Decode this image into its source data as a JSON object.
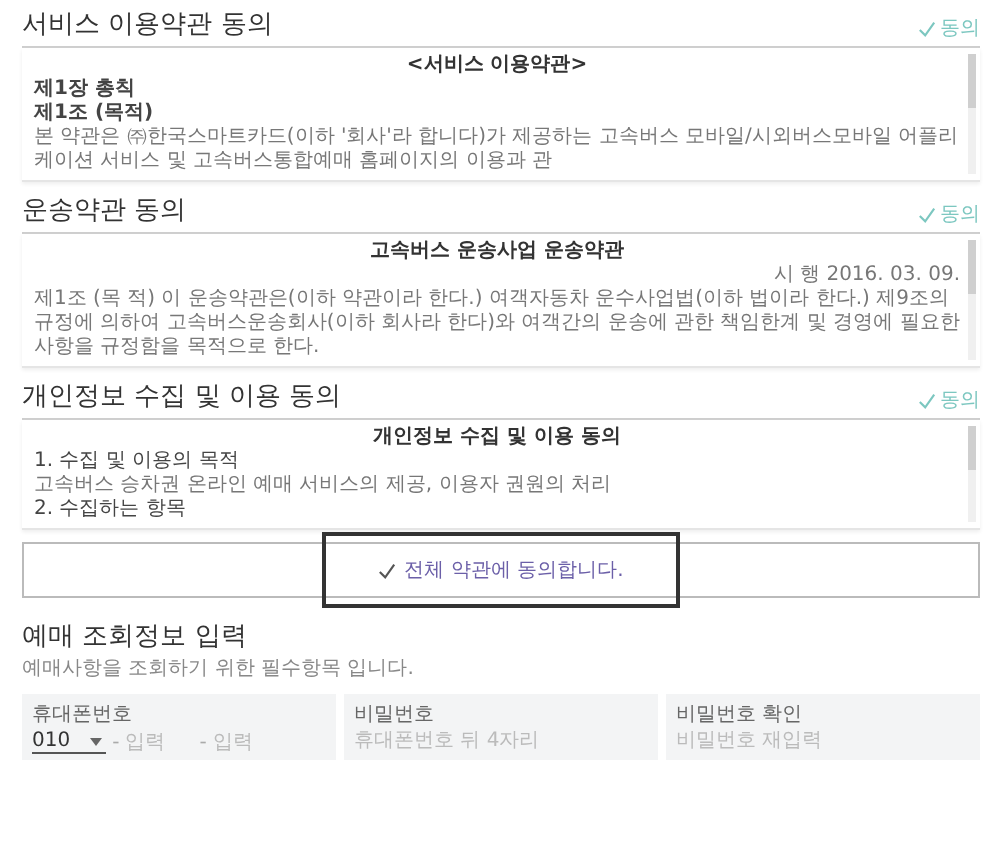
{
  "sections": [
    {
      "title": "서비스 이용약관 동의",
      "agree_label": "동의",
      "content": [
        {
          "kind": "heading",
          "text": "<서비스 이용약관>"
        },
        {
          "kind": "bold",
          "text": "제1장 총칙"
        },
        {
          "kind": "bold",
          "text": "제1조 (목적)"
        },
        {
          "kind": "text",
          "text": "본 약관은 ㈜한국스마트카드(이하 '회사'라 합니다)가 제공하는 고속버스 모바일/시외버스모바일 어플리케이션 서비스 및 고속버스통합예매 홈페이지의 이용과 관"
        }
      ]
    },
    {
      "title": "운송약관 동의",
      "agree_label": "동의",
      "content": [
        {
          "kind": "heading",
          "text": "고속버스 운송사업 운송약관"
        },
        {
          "kind": "date",
          "text": "시 행 2016. 03. 09."
        },
        {
          "kind": "text",
          "text": "제1조 (목 적) 이 운송약관은(이하 약관이라 한다.) 여객자동차 운수사업법(이하 법이라 한다.) 제9조의 규정에 의하여 고속버스운송회사(이하 회사라 한다)와 여객간의 운송에 관한 책임한계 및 경영에 필요한 사항을 규정함을 목적으로 한다."
        }
      ]
    },
    {
      "title": "개인정보 수집 및 이용 동의",
      "agree_label": "동의",
      "content": [
        {
          "kind": "heading",
          "text": "개인정보 수집 및 이용 동의"
        },
        {
          "kind": "item",
          "text": "1. 수집 및 이용의 목적"
        },
        {
          "kind": "text",
          "text": "고속버스 승차권 온라인 예매 서비스의 제공, 이용자 권원의 처리"
        },
        {
          "kind": "item",
          "text": "2. 수집하는 항목"
        }
      ]
    }
  ],
  "agree_all": {
    "label": "전체 약관에 동의합니다."
  },
  "reservation": {
    "title": "예매 조회정보 입력",
    "subtitle": "예매사항을 조회하기 위한 필수항목 입니다.",
    "phone": {
      "label": "휴대폰번호",
      "prefix": "010",
      "separator_1": "-",
      "placeholder_1": "입력",
      "separator_2": "-",
      "placeholder_2": "입력"
    },
    "password": {
      "label": "비밀번호",
      "placeholder": "휴대폰번호 뒤 4자리"
    },
    "password_confirm": {
      "label": "비밀번호 확인",
      "placeholder": "비밀번호 재입력"
    }
  }
}
